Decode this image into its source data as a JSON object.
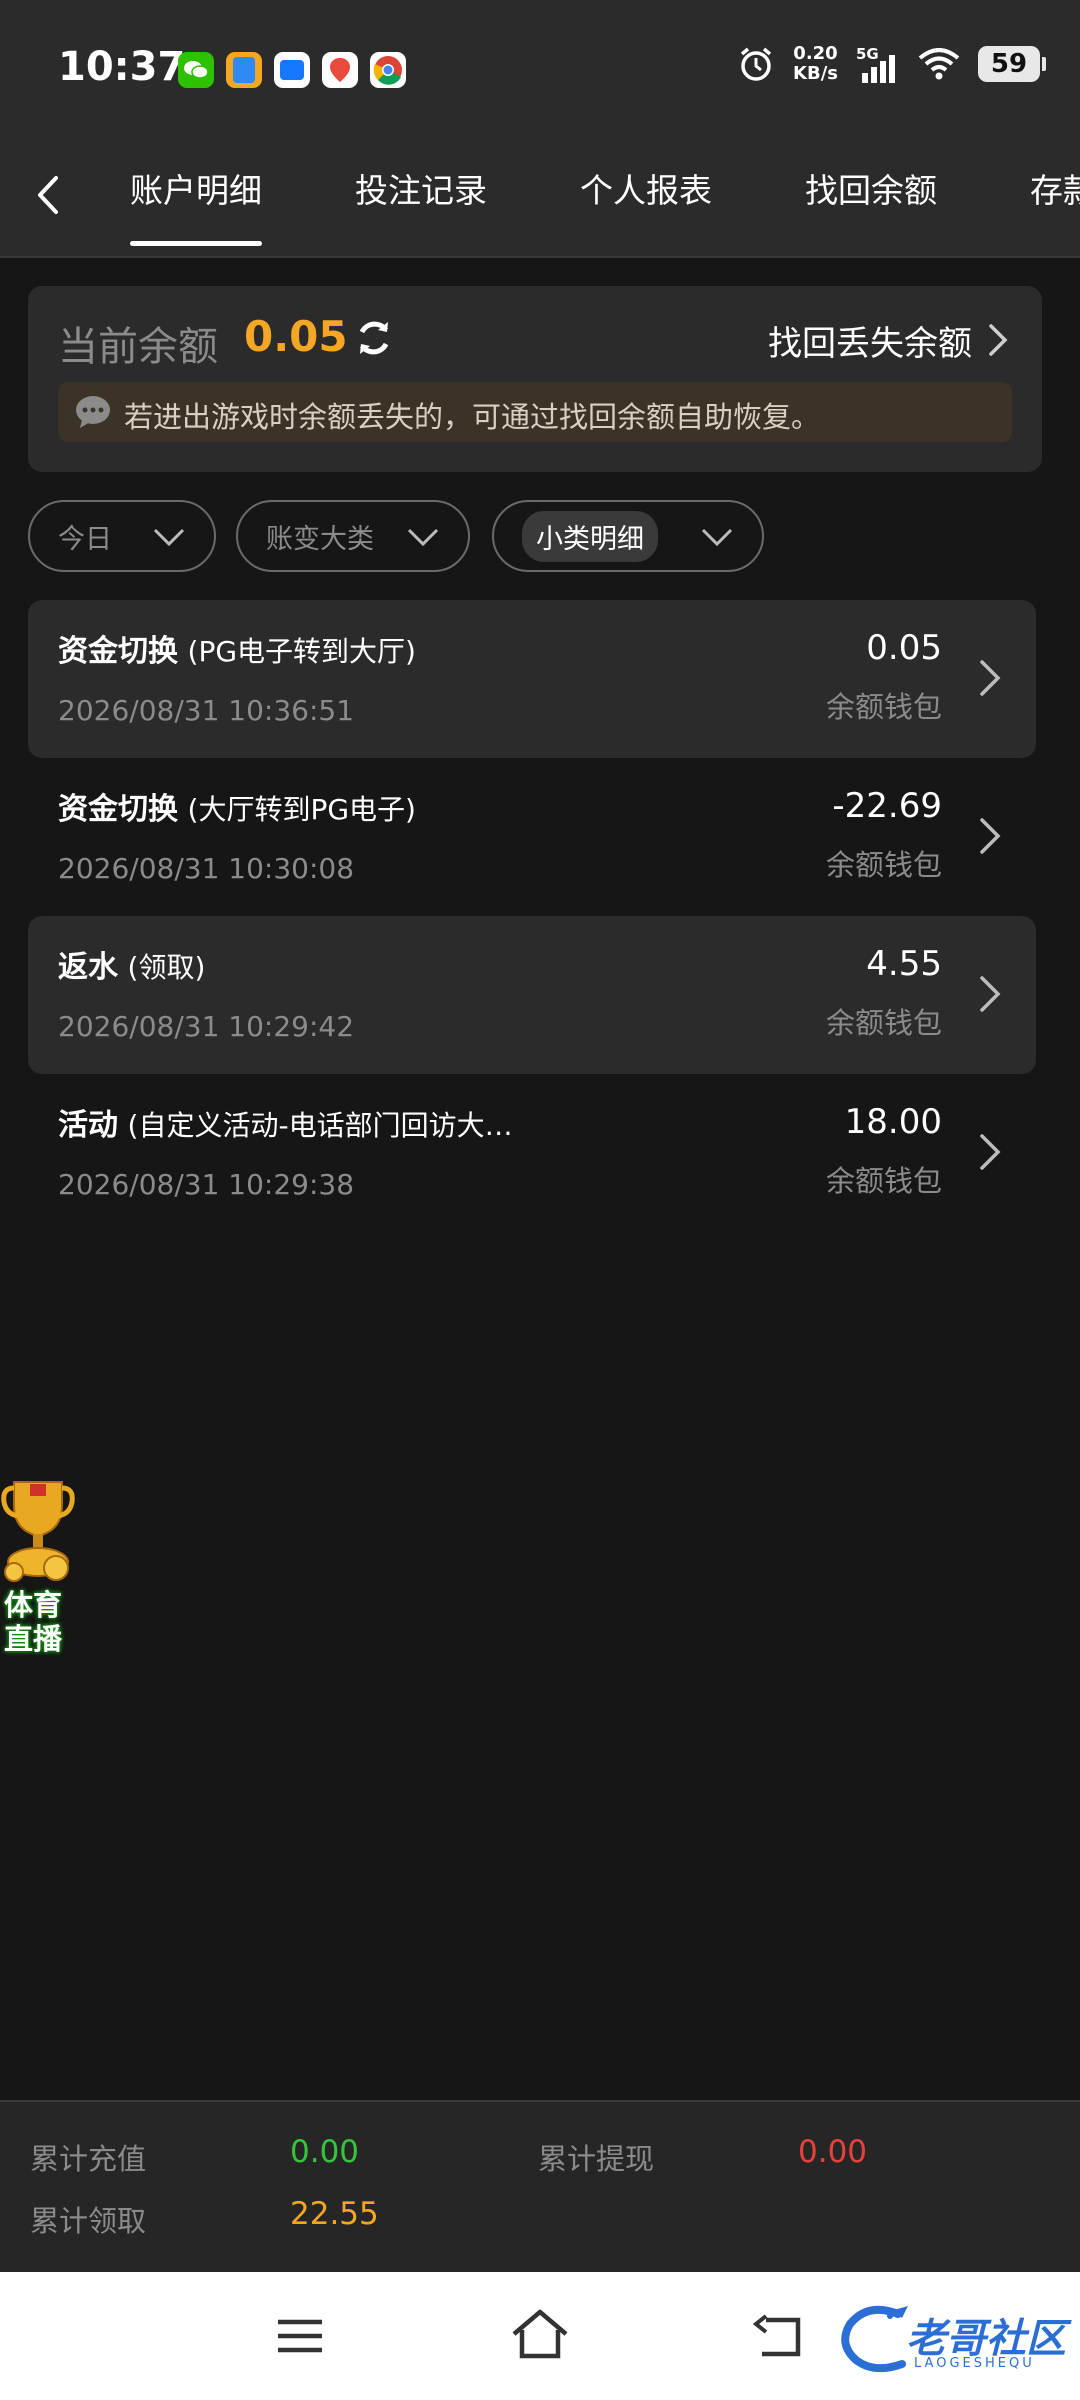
{
  "status_bar": {
    "time": "10:37",
    "net_speed_value": "0.20",
    "net_speed_unit": "KB/s",
    "network_type": "5G",
    "battery": "59",
    "app_icons": [
      {
        "name": "wechat-icon",
        "color": "#2dc100"
      },
      {
        "name": "files-icon",
        "color": "#2f8af5"
      },
      {
        "name": "chat-app-icon",
        "color": "#1677ff"
      },
      {
        "name": "map-app-icon",
        "color": "#e84a3b"
      },
      {
        "name": "chrome-icon",
        "color": "#f4b400"
      }
    ]
  },
  "tabs": [
    {
      "label": "账户明细",
      "active": true
    },
    {
      "label": "投注记录",
      "active": false
    },
    {
      "label": "个人报表",
      "active": false
    },
    {
      "label": "找回余额",
      "active": false
    },
    {
      "label": "存款",
      "active": false
    }
  ],
  "balance": {
    "label": "当前余额",
    "value": "0.05",
    "recover_link": "找回丢失余额",
    "tip": "若进出游戏时余额丢失的，可通过找回余额自助恢复。"
  },
  "filters": [
    {
      "label": "今日",
      "selected": false
    },
    {
      "label": "账变大类",
      "selected": false
    },
    {
      "label": "小类明细",
      "selected": true
    }
  ],
  "records": [
    {
      "type": "资金切换",
      "detail": "(PG电子转到大厅)",
      "time": "2026/08/31 10:36:51",
      "amount": "0.05",
      "wallet": "余额钱包"
    },
    {
      "type": "资金切换",
      "detail": "(大厅转到PG电子)",
      "time": "2026/08/31 10:30:08",
      "amount": "-22.69",
      "wallet": "余额钱包"
    },
    {
      "type": "返水",
      "detail": "(领取)",
      "time": "2026/08/31 10:29:42",
      "amount": "4.55",
      "wallet": "余额钱包"
    },
    {
      "type": "活动",
      "detail": "(自定义活动-电话部门回访大…",
      "time": "2026/08/31 10:29:38",
      "amount": "18.00",
      "wallet": "余额钱包"
    }
  ],
  "sports_widget": {
    "line1": "体育",
    "line2": "直播"
  },
  "summary": {
    "deposit_label": "累计充值",
    "deposit_value": "0.00",
    "deposit_color": "#35c43a",
    "withdraw_label": "累计提现",
    "withdraw_value": "0.00",
    "withdraw_color": "#e8413c",
    "claim_label": "累计领取",
    "claim_value": "22.55",
    "claim_color": "#f5a623"
  },
  "watermark": {
    "main": "老哥社区",
    "sub": "LAOGESHEQU"
  }
}
